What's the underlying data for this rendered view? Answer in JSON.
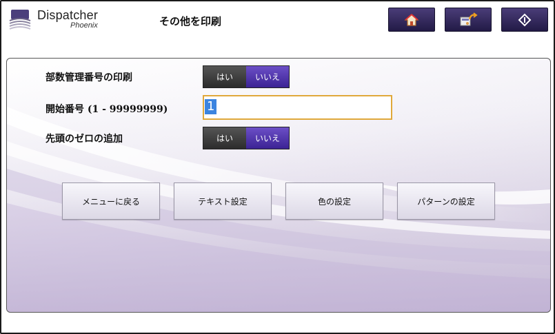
{
  "header": {
    "app_name": "Dispatcher",
    "app_subname": "Phoenix",
    "title": "その他を印刷",
    "buttons": [
      {
        "icon": "home-icon"
      },
      {
        "icon": "return-icon"
      },
      {
        "icon": "start-icon"
      }
    ]
  },
  "form": {
    "copy_number_print": {
      "label": "部数管理番号の印刷",
      "yes": "はい",
      "no": "いいえ",
      "selected": "いいえ"
    },
    "start_number": {
      "label": "開始番号 (1 - 99999999)",
      "value": "1"
    },
    "leading_zero": {
      "label": "先頭のゼロの追加",
      "yes": "はい",
      "no": "いいえ",
      "selected": "いいえ"
    }
  },
  "actions": {
    "back_menu": "メニューに戻る",
    "text_settings": "テキスト設定",
    "color_settings": "色の設定",
    "pattern_settings": "パターンの設定"
  },
  "colors": {
    "header_button": "#2e2455",
    "toggle_selected": "#4b2fa8",
    "toggle_unselected": "#3a3a3a",
    "input_border": "#e0a83a",
    "selection": "#3b84e0"
  }
}
